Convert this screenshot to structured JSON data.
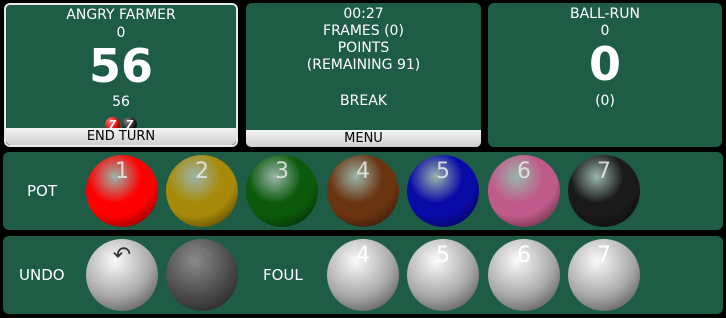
{
  "left_player": {
    "name": "ANGRY FARMER",
    "frames": "0",
    "score": "56",
    "break_score": "56",
    "break_balls": [
      "7",
      "7"
    ],
    "end_turn_label": "END TURN"
  },
  "center": {
    "timer": "00:27",
    "frames": "FRAMES (0)",
    "points": "POINTS",
    "remaining": "(REMAINING 91)",
    "status": "BREAK",
    "menu_label": "MENU"
  },
  "right_player": {
    "name": "BALL-RUN",
    "frames": "0",
    "score": "0",
    "break_score": "(0)"
  },
  "pot_row": {
    "label": "POT",
    "balls": [
      {
        "num": "1",
        "color": "#ff0000"
      },
      {
        "num": "2",
        "color": "#a88a0a"
      },
      {
        "num": "3",
        "color": "#0b5a0b"
      },
      {
        "num": "4",
        "color": "#6b3410"
      },
      {
        "num": "5",
        "color": "#0a0aa8"
      },
      {
        "num": "6",
        "color": "#c05a8a"
      },
      {
        "num": "7",
        "color": "#1a1a1a"
      }
    ]
  },
  "undo_row": {
    "undo_label": "UNDO",
    "undo_icon": "undo-arrow",
    "redo_icon": "redo-arrow",
    "undo_glyph": "↶",
    "redo_glyph": "↷",
    "foul_label": "FOUL",
    "foul_balls": [
      "4",
      "5",
      "6",
      "7"
    ]
  }
}
